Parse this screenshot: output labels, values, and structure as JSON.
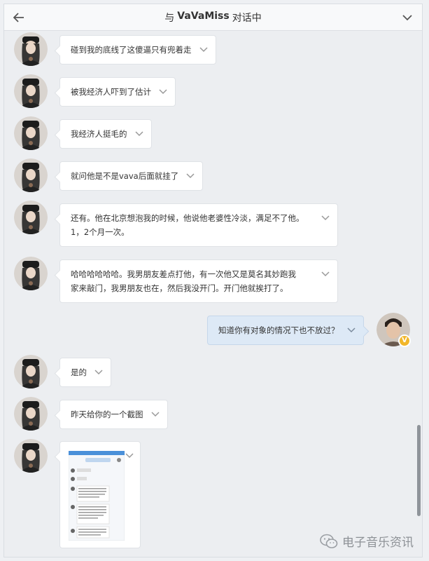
{
  "header": {
    "prefix": "与",
    "contact_name": "VaVaMiss",
    "suffix": "对话中"
  },
  "messages": [
    {
      "text": "碰到我的底线了这傻逼只有兜着走"
    },
    {
      "text": "被我经济人吓到了估计"
    },
    {
      "text": "我经济人挺毛的"
    },
    {
      "text": "就问他是不是vava后面就挂了"
    },
    {
      "line1": "还有。他在北京想泡我的时候，他说他老婆性冷淡，满足不了他。",
      "line2": "1，2个月一次。"
    },
    {
      "line1": "哈哈哈哈哈哈。我男朋友差点打他，有一次他又是莫名其妙跑我",
      "line2": "家来敲门，我男朋友也在，然后我没开门。开门他就挨打了。"
    },
    {
      "text": "知道你有对象的情况下也不放过？"
    },
    {
      "text": "是的"
    },
    {
      "text": "昨天给你的一个截图"
    }
  ],
  "badge_letter": "V",
  "watermark": "电子音乐资讯",
  "colors": {
    "outgoing_bubble": "#dde9f6",
    "incoming_bubble": "#ffffff",
    "badge": "#f1b62a"
  }
}
